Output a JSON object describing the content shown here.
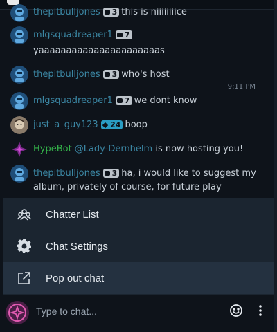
{
  "messages": [
    {
      "user": "thepitbulljones",
      "badge": "3",
      "text": "this is niiiiiiiice"
    },
    {
      "user": "mlgsquadreaper1",
      "badge": "7",
      "text": "yaaaaaaaaaaaaaaaaaaaaaas"
    },
    {
      "user": "thepitbulljones",
      "badge": "3",
      "text": "who's host"
    },
    {
      "user": "mlgsquadreaper1",
      "badge": "7",
      "text": "we dont know"
    },
    {
      "user": "just_a_guy123",
      "badge": "24",
      "text": "boop"
    },
    {
      "user": "HypeBot",
      "mention": "@Lady-Dernhelm",
      "text": "is now hosting you!"
    },
    {
      "user": "thepitbulljones",
      "badge": "3",
      "text": "ha, i would like to suggest my album, privately of course, for future play"
    }
  ],
  "timestamp": "9:11 PM",
  "menu": {
    "chatter_list": "Chatter List",
    "chat_settings": "Chat Settings",
    "pop_out": "Pop out chat"
  },
  "input": {
    "placeholder": "Type to chat..."
  },
  "colors": {
    "username": "#3b86a3",
    "bot": "#34b24a",
    "menu_bg": "#1b2530",
    "menu_highlight": "#243140",
    "accent": "#e05ab0"
  }
}
